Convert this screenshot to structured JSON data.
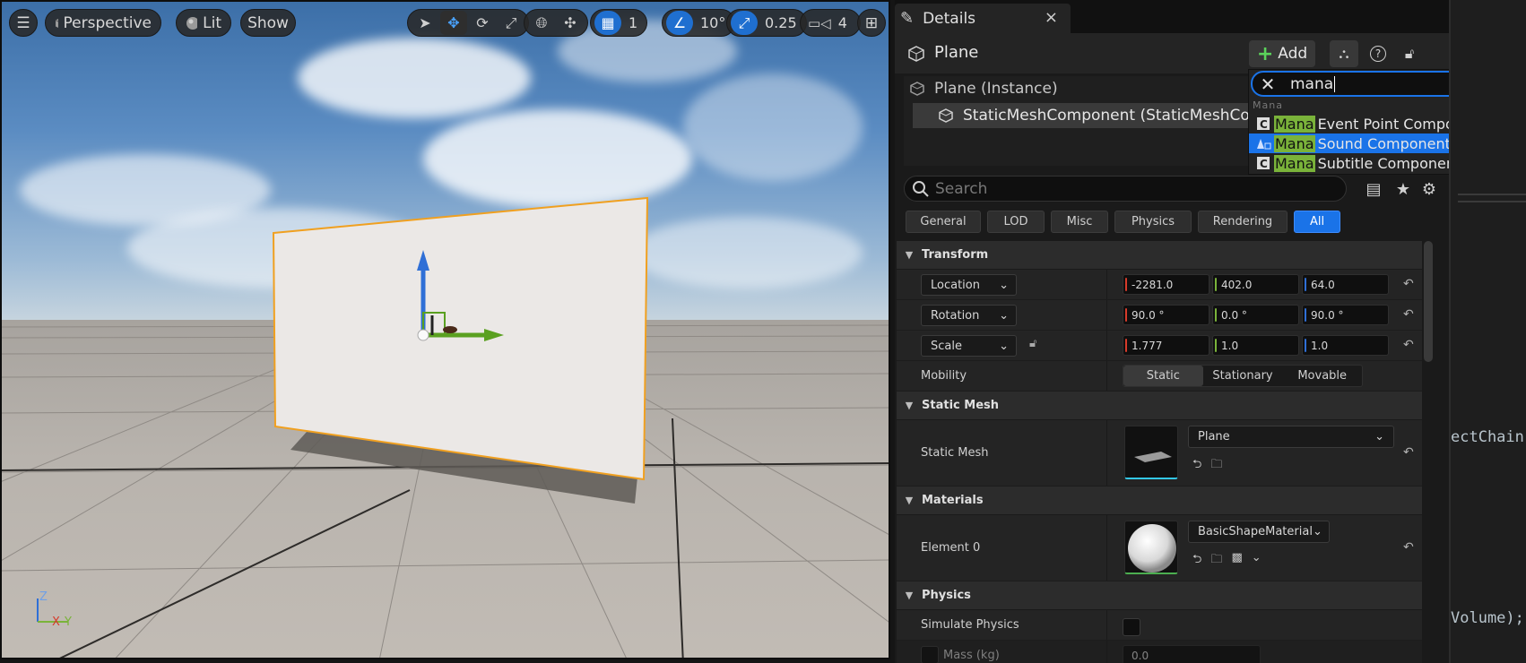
{
  "viewport": {
    "menu_icon": "hamburger-icon",
    "perspective_label": "Perspective",
    "lit_label": "Lit",
    "show_label": "Show",
    "grid_snap_value": "1",
    "rotation_snap_value": "10°",
    "scale_snap_value": "0.25",
    "camera_speed_value": "4",
    "axis_labels": {
      "z": "Z",
      "x": "X",
      "y": "Y"
    }
  },
  "details": {
    "tab_title": "Details",
    "tab_close": "×",
    "actor_name": "Plane",
    "add_label": "Add",
    "tree": [
      {
        "label": "Plane (Instance)"
      },
      {
        "label": "StaticMeshComponent (StaticMeshComp"
      }
    ],
    "search_placeholder": "Search",
    "filters": [
      "General",
      "LOD",
      "Misc",
      "Physics",
      "Rendering",
      "All"
    ],
    "active_filter": "All",
    "transform": {
      "header": "Transform",
      "location_label": "Location",
      "location": [
        "-2281.0",
        "402.0",
        "64.0"
      ],
      "rotation_label": "Rotation",
      "rotation": [
        "90.0 °",
        "0.0 °",
        "90.0 °"
      ],
      "scale_label": "Scale",
      "scale": [
        "1.777",
        "1.0",
        "1.0"
      ],
      "mobility_label": "Mobility",
      "mobility_options": [
        "Static",
        "Stationary",
        "Movable"
      ],
      "mobility_selected": "Static"
    },
    "static_mesh": {
      "header": "Static Mesh",
      "label": "Static Mesh",
      "value": "Plane"
    },
    "materials": {
      "header": "Materials",
      "element_label": "Element 0",
      "value": "BasicShapeMaterial"
    },
    "physics": {
      "header": "Physics",
      "simulate_label": "Simulate Physics",
      "mass_label": "Mass (kg)",
      "mass_value": "0.0"
    }
  },
  "add_popup": {
    "search_text": "mana",
    "group_label": "Mana",
    "items": [
      {
        "highlight": "Mana",
        "rest": "Event Point Component",
        "icon": "cpp-class-icon"
      },
      {
        "highlight": "Mana",
        "rest": "Sound Component",
        "icon": "sound-component-icon"
      },
      {
        "highlight": "Mana",
        "rest": "Subtitle Component",
        "icon": "cpp-class-icon"
      }
    ],
    "selected_index": 1
  },
  "code": {
    "line1": "ectChain",
    "line2": "Volume);"
  },
  "colors": {
    "accent_blue": "#1a73e8",
    "highlight_green": "#7ab33a",
    "axis_x": "#d63a2a",
    "axis_y": "#7ab33a",
    "axis_z": "#2f6fd6",
    "selection_outline": "#f0a020"
  }
}
